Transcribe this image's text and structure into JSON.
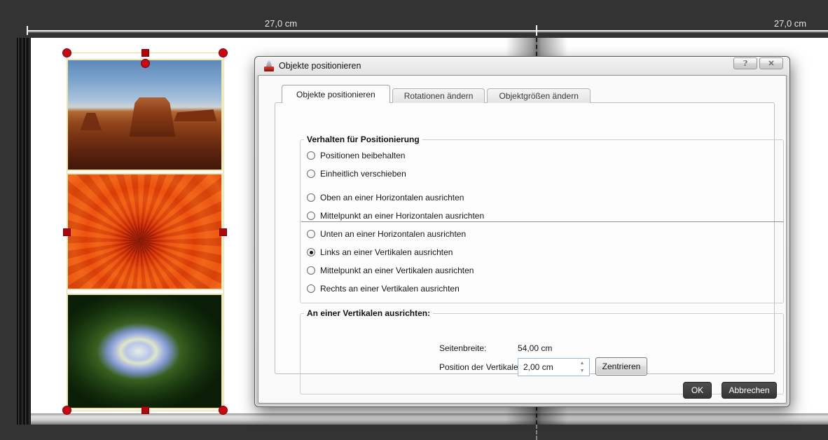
{
  "ruler": {
    "left_label": "27,0 cm",
    "right_label": "27,0 cm"
  },
  "page": {
    "photos": [
      "monument-valley",
      "orange-dahlia",
      "hydrangea"
    ]
  },
  "dialog": {
    "title": "Objekte positionieren",
    "help_glyph": "?",
    "close_glyph": "✕",
    "tabs": [
      {
        "label": "Objekte positionieren",
        "active": true
      },
      {
        "label": "Rotationen ändern",
        "active": false
      },
      {
        "label": "Objektgrößen ändern",
        "active": false
      }
    ],
    "behavior_group": {
      "title": "Verhalten für Positionierung",
      "options": [
        {
          "label": "Positionen beibehalten",
          "selected": false
        },
        {
          "label": "Einheitlich verschieben",
          "selected": false
        }
      ],
      "align_options": [
        {
          "label": "Oben an einer Horizontalen ausrichten",
          "selected": false
        },
        {
          "label": "Mittelpunkt an einer Horizontalen ausrichten",
          "selected": false
        },
        {
          "label": "Unten an einer Horizontalen ausrichten",
          "selected": false
        },
        {
          "label": "Links an einer Vertikalen ausrichten",
          "selected": true
        },
        {
          "label": "Mittelpunkt an einer Vertikalen ausrichten",
          "selected": false
        },
        {
          "label": "Rechts an einer Vertikalen ausrichten",
          "selected": false
        }
      ]
    },
    "vertical_group": {
      "title": "An einer Vertikalen ausrichten:",
      "page_width_label": "Seitenbreite:",
      "page_width_value": "54,00 cm",
      "position_label": "Position der Vertikalen:",
      "position_value": "2,00 cm",
      "spinner_up_glyph": "▲",
      "spinner_down_glyph": "▼",
      "center_button_label": "Zentrieren"
    },
    "ok_label": "OK",
    "cancel_label": "Abbrechen"
  },
  "colors": {
    "canvas_bg": "#333333",
    "handle_red": "#c50a12",
    "selection_border": "#ead892",
    "dark_button_bg": "#3d3d3d"
  }
}
